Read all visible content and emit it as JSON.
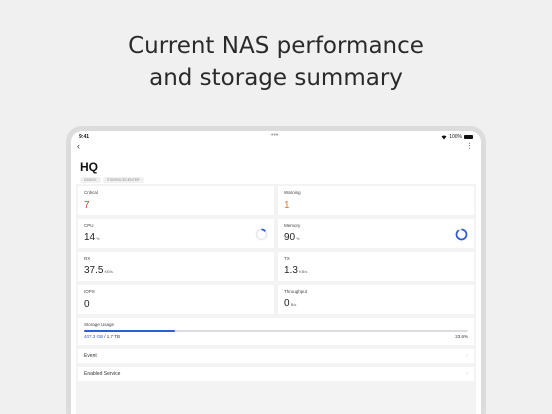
{
  "headline": {
    "line1": "Current NAS performance",
    "line2": "and storage summary"
  },
  "statusbar": {
    "time": "9:41",
    "dots": "•••",
    "battery_text": "100%",
    "wifi_icon": "wifi-icon",
    "battery_icon": "battery-icon"
  },
  "nav": {
    "back_glyph": "‹",
    "more_glyph": "⋮"
  },
  "device": {
    "name": "HQ",
    "tags": [
      "DS923+",
      "ITSERVICECENTER"
    ]
  },
  "cards": {
    "critical": {
      "label": "Critical",
      "value": "7"
    },
    "warning": {
      "label": "Warning",
      "value": "1"
    },
    "cpu": {
      "label": "CPU",
      "value": "14",
      "unit": "%",
      "percent": 14
    },
    "memory": {
      "label": "Memory",
      "value": "90",
      "unit": "%",
      "percent": 90
    },
    "rx": {
      "label": "RX",
      "value": "37.5",
      "unit": "KB/s"
    },
    "tx": {
      "label": "TX",
      "value": "1.3",
      "unit": "KB/s"
    },
    "iops": {
      "label": "IOPS",
      "value": "0"
    },
    "throughput": {
      "label": "Throughput",
      "value": "0",
      "unit": "B/s"
    }
  },
  "storage": {
    "label": "Storage Usage",
    "used": "407.3 GB",
    "total": " / 1.7 TB",
    "percent_text": "23.6%",
    "fraction": 0.236
  },
  "rows": {
    "event": "Event",
    "enabled_service": "Enabled Service",
    "chevron": "›"
  },
  "colors": {
    "critical": "#d2462c",
    "warning": "#e07a22",
    "accent": "#2f5ecf",
    "ring_track": "#dcdde3"
  }
}
